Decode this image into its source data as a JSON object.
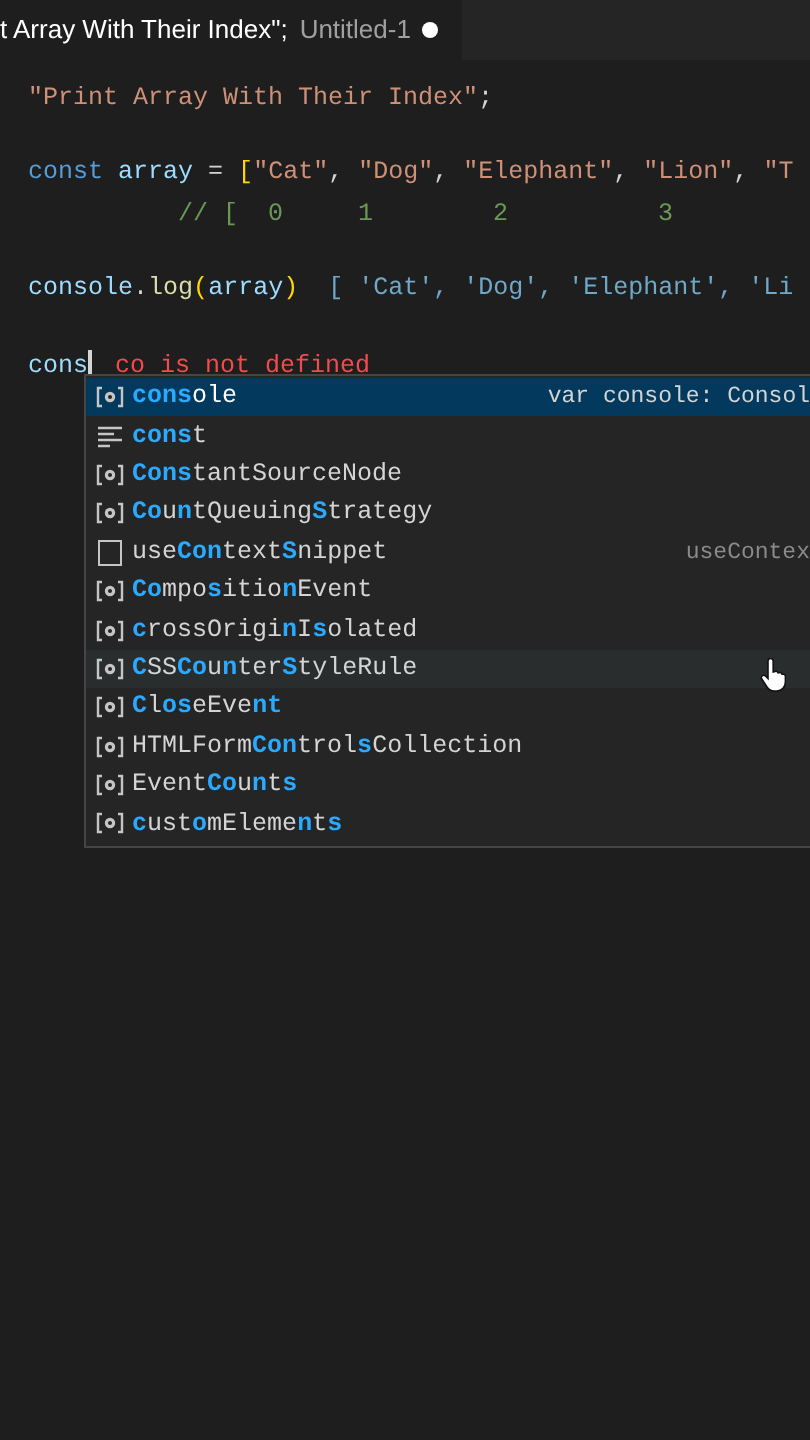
{
  "tab": {
    "title": "t Array With Their Index\";",
    "file": "Untitled-1",
    "modified": true
  },
  "code_lines": [
    {
      "tokens": [
        {
          "text": "\"Print Array With Their Index\"",
          "kind": "string"
        },
        {
          "text": ";",
          "kind": "punct"
        }
      ]
    },
    {
      "tokens": [
        {
          "text": "const ",
          "kind": "keyword"
        },
        {
          "text": "array",
          "kind": "variable"
        },
        {
          "text": " = ",
          "kind": "punct"
        },
        {
          "text": "[",
          "kind": "bracket"
        },
        {
          "text": "\"Cat\"",
          "kind": "string"
        },
        {
          "text": ", ",
          "kind": "punct"
        },
        {
          "text": "\"Dog\"",
          "kind": "string"
        },
        {
          "text": ", ",
          "kind": "punct"
        },
        {
          "text": "\"Elephant\"",
          "kind": "string"
        },
        {
          "text": ", ",
          "kind": "punct"
        },
        {
          "text": "\"Lion\"",
          "kind": "string"
        },
        {
          "text": ", ",
          "kind": "punct"
        },
        {
          "text": "\"T",
          "kind": "string"
        }
      ]
    },
    {
      "tokens": [
        {
          "text": "          // [  0     1        2          3",
          "kind": "comment"
        }
      ]
    },
    {
      "tokens": [
        {
          "text": "console",
          "kind": "variable"
        },
        {
          "text": ".",
          "kind": "punct"
        },
        {
          "text": "log",
          "kind": "function"
        },
        {
          "text": "(",
          "kind": "bracket"
        },
        {
          "text": "array",
          "kind": "variable"
        },
        {
          "text": ")",
          "kind": "bracket"
        },
        {
          "text": "  [ 'Cat', 'Dog', 'Elephant', 'Li",
          "kind": "result"
        }
      ]
    },
    {
      "tokens": [
        {
          "text": "cons",
          "kind": "variable"
        }
      ],
      "cursor": true,
      "error": "co is not defined"
    }
  ],
  "suggestions": [
    {
      "kind": "variable",
      "selected": true,
      "hovered": false,
      "parts": [
        {
          "text": "cons",
          "match": true
        },
        {
          "text": "ole",
          "match": false
        }
      ],
      "detail": "var console: Consol"
    },
    {
      "kind": "keyword",
      "selected": false,
      "hovered": false,
      "parts": [
        {
          "text": "cons",
          "match": true
        },
        {
          "text": "t",
          "match": false
        }
      ]
    },
    {
      "kind": "variable",
      "selected": false,
      "hovered": false,
      "parts": [
        {
          "text": "Cons",
          "match": true
        },
        {
          "text": "tantSourceNode",
          "match": false
        }
      ]
    },
    {
      "kind": "variable",
      "selected": false,
      "hovered": false,
      "parts": [
        {
          "text": "Co",
          "match": true
        },
        {
          "text": "u",
          "match": false
        },
        {
          "text": "n",
          "match": true
        },
        {
          "text": "tQueuing",
          "match": false
        },
        {
          "text": "S",
          "match": true
        },
        {
          "text": "trategy",
          "match": false
        }
      ]
    },
    {
      "kind": "snippet",
      "selected": false,
      "hovered": false,
      "parts": [
        {
          "text": "use",
          "match": false
        },
        {
          "text": "Con",
          "match": true
        },
        {
          "text": "text",
          "match": false
        },
        {
          "text": "S",
          "match": true
        },
        {
          "text": "nippet",
          "match": false
        }
      ],
      "detail": "useContex"
    },
    {
      "kind": "variable",
      "selected": false,
      "hovered": false,
      "parts": [
        {
          "text": "Co",
          "match": true
        },
        {
          "text": "mpo",
          "match": false
        },
        {
          "text": "s",
          "match": true
        },
        {
          "text": "itio",
          "match": false
        },
        {
          "text": "n",
          "match": true
        },
        {
          "text": "Event",
          "match": false
        }
      ]
    },
    {
      "kind": "variable",
      "selected": false,
      "hovered": false,
      "parts": [
        {
          "text": "c",
          "match": true
        },
        {
          "text": "rossOrigi",
          "match": false
        },
        {
          "text": "n",
          "match": true
        },
        {
          "text": "I",
          "match": false
        },
        {
          "text": "s",
          "match": true
        },
        {
          "text": "olated",
          "match": false
        }
      ]
    },
    {
      "kind": "variable",
      "selected": false,
      "hovered": true,
      "parts": [
        {
          "text": "C",
          "match": true
        },
        {
          "text": "SS",
          "match": false
        },
        {
          "text": "Co",
          "match": true
        },
        {
          "text": "u",
          "match": false
        },
        {
          "text": "n",
          "match": true
        },
        {
          "text": "ter",
          "match": false
        },
        {
          "text": "S",
          "match": true
        },
        {
          "text": "tyleRule",
          "match": false
        }
      ]
    },
    {
      "kind": "variable",
      "selected": false,
      "hovered": false,
      "parts": [
        {
          "text": "C",
          "match": true
        },
        {
          "text": "l",
          "match": false
        },
        {
          "text": "os",
          "match": true
        },
        {
          "text": "eEve",
          "match": false
        },
        {
          "text": "nt",
          "match": true
        }
      ]
    },
    {
      "kind": "variable",
      "selected": false,
      "hovered": false,
      "parts": [
        {
          "text": "HTMLForm",
          "match": false
        },
        {
          "text": "Con",
          "match": true
        },
        {
          "text": "trol",
          "match": false
        },
        {
          "text": "s",
          "match": true
        },
        {
          "text": "Collection",
          "match": false
        }
      ]
    },
    {
      "kind": "variable",
      "selected": false,
      "hovered": false,
      "parts": [
        {
          "text": "Event",
          "match": false
        },
        {
          "text": "Co",
          "match": true
        },
        {
          "text": "u",
          "match": false
        },
        {
          "text": "n",
          "match": true
        },
        {
          "text": "t",
          "match": false
        },
        {
          "text": "s",
          "match": true
        }
      ]
    },
    {
      "kind": "variable",
      "selected": false,
      "hovered": false,
      "parts": [
        {
          "text": "c",
          "match": true
        },
        {
          "text": "ust",
          "match": false
        },
        {
          "text": "o",
          "match": true
        },
        {
          "text": "mEleme",
          "match": false
        },
        {
          "text": "n",
          "match": true
        },
        {
          "text": "t",
          "match": false
        },
        {
          "text": "s",
          "match": true
        }
      ]
    }
  ]
}
